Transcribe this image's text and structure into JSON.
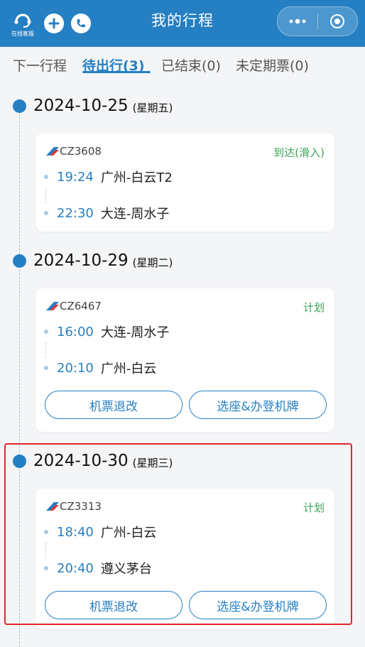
{
  "header": {
    "service_label": "在线客服",
    "title": "我的行程"
  },
  "tabs": [
    {
      "label": "下一行程",
      "active": false
    },
    {
      "label": "待出行(3)",
      "active": true
    },
    {
      "label": "已结束(0)",
      "active": false
    },
    {
      "label": "未定期票(0)",
      "active": false
    }
  ],
  "trips": [
    {
      "date": "2024-10-25",
      "weekday": "(星期五)",
      "flight_no": "CZ3608",
      "status": "到达(滑入)",
      "dep_time": "19:24",
      "dep_place": "广州-白云T2",
      "arr_time": "22:30",
      "arr_place": "大连-周水子",
      "buttons": []
    },
    {
      "date": "2024-10-29",
      "weekday": "(星期二)",
      "flight_no": "CZ6467",
      "status": "计划",
      "dep_time": "16:00",
      "dep_place": "大连-周水子",
      "arr_time": "20:10",
      "arr_place": "广州-白云",
      "buttons": [
        "机票退改",
        "选座&办登机牌"
      ]
    },
    {
      "date": "2024-10-30",
      "weekday": "(星期三)",
      "flight_no": "CZ3313",
      "status": "计划",
      "dep_time": "18:40",
      "dep_place": "广州-白云",
      "arr_time": "20:40",
      "arr_place": "遵义茅台",
      "buttons": [
        "机票退改",
        "选座&办登机牌"
      ]
    }
  ],
  "colors": {
    "brand": "#2580c3",
    "status_green": "#3aa356",
    "highlight_red": "#e0262b"
  }
}
